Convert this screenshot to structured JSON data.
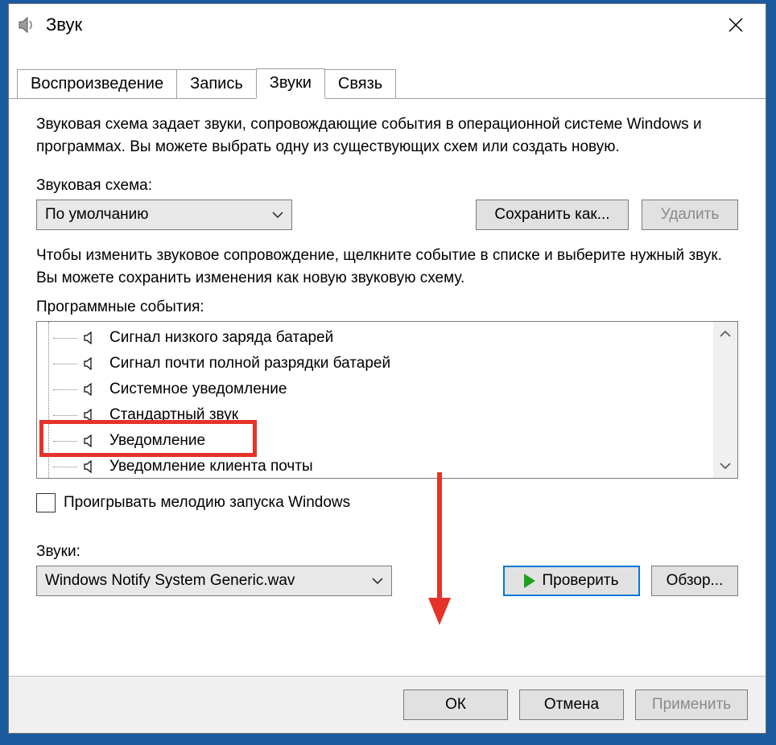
{
  "window": {
    "title": "Звук"
  },
  "tabs": [
    "Воспроизведение",
    "Запись",
    "Звуки",
    "Связь"
  ],
  "active_tab_index": 2,
  "content": {
    "description": "Звуковая схема задает звуки, сопровождающие события в операционной системе Windows и программах. Вы можете выбрать одну из существующих схем или создать новую.",
    "scheme_label": "Звуковая схема:",
    "scheme_value": "По умолчанию",
    "save_as_btn": "Сохранить как...",
    "delete_btn": "Удалить",
    "events_desc": "Чтобы изменить звуковое сопровождение, щелкните событие в списке и выберите нужный звук. Вы можете сохранить изменения как новую звуковую схему.",
    "events_label": "Программные события:",
    "events": [
      "Сигнал низкого заряда батарей",
      "Сигнал почти полной разрядки батарей",
      "Системное уведомление",
      "Стандартный звук",
      "Уведомление",
      "Уведомление клиента почты"
    ],
    "selected_event_index": 4,
    "startup_chk_label": "Проигрывать мелодию запуска Windows",
    "startup_checked": false,
    "sounds_label": "Звуки:",
    "sound_value": "Windows Notify System Generic.wav",
    "test_btn": "Проверить",
    "browse_btn": "Обзор..."
  },
  "footer": {
    "ok": "ОК",
    "cancel": "Отмена",
    "apply": "Применить"
  }
}
